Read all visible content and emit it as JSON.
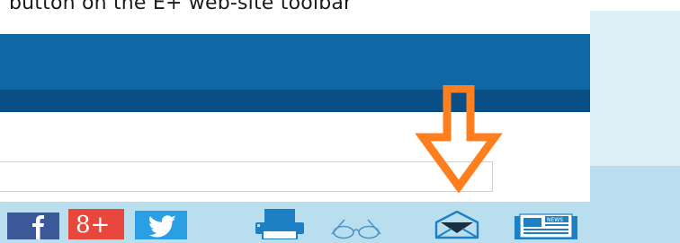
{
  "caption": {
    "text": "button on the E+ web-site toolbar"
  },
  "search": {
    "value": "",
    "placeholder": ""
  },
  "toolbar": {
    "items": [
      {
        "name": "facebook",
        "icon": "facebook-icon"
      },
      {
        "name": "google-plus",
        "icon": "google-plus-icon",
        "label": "8+"
      },
      {
        "name": "twitter",
        "icon": "twitter-icon"
      },
      {
        "name": "print",
        "icon": "printer-icon"
      },
      {
        "name": "read",
        "icon": "glasses-icon"
      },
      {
        "name": "email",
        "icon": "envelope-icon"
      },
      {
        "name": "news",
        "icon": "newspaper-icon",
        "label": "NEWS"
      }
    ]
  },
  "annotation": {
    "icon": "down-arrow-icon",
    "color": "#ff7f1e"
  },
  "colors": {
    "header": "#0f67a3",
    "header_dark": "#0a4e86",
    "toolbar": "#b9dfee",
    "panel": "#ddeff6",
    "icon_blue": "#1d7fc4",
    "facebook": "#3b5998",
    "google_plus": "#e8473b",
    "twitter": "#2a9fe3"
  }
}
